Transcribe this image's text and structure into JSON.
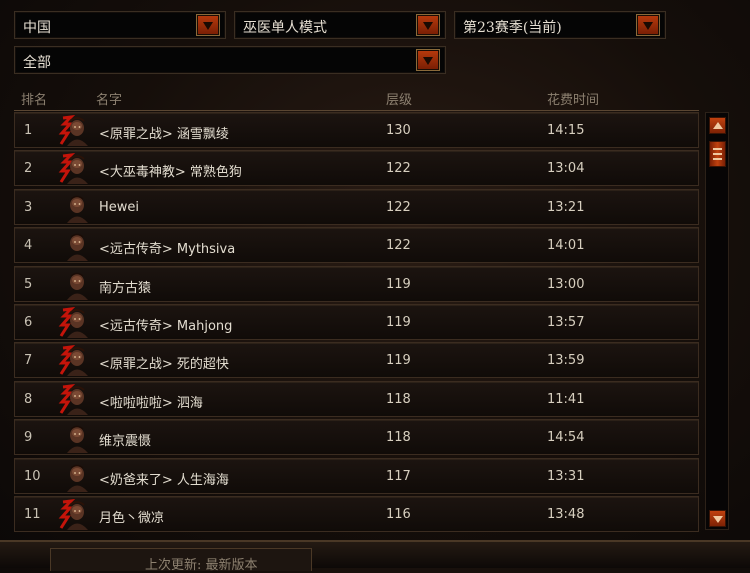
{
  "filters": {
    "region": "中国",
    "mode": "巫医单人模式",
    "season": "第23赛季(当前)",
    "category": "全部"
  },
  "columns": {
    "rank": "排名",
    "name": "名字",
    "level": "层级",
    "time": "花费时间"
  },
  "rows": [
    {
      "rank": "1",
      "name": "<原罪之战> 涵雪飘绫",
      "level": "130",
      "time": "14:15",
      "portrait": "female-witch-doctor"
    },
    {
      "rank": "2",
      "name": "<大巫毒神教> 常熟色狗",
      "level": "122",
      "time": "13:04",
      "portrait": "female-witch-doctor"
    },
    {
      "rank": "3",
      "name": "Hewei",
      "level": "122",
      "time": "13:21",
      "portrait": "male-witch-doctor"
    },
    {
      "rank": "4",
      "name": "<远古传奇> Mythsiva",
      "level": "122",
      "time": "14:01",
      "portrait": "male-witch-doctor"
    },
    {
      "rank": "5",
      "name": "南方古猿",
      "level": "119",
      "time": "13:00",
      "portrait": "male-witch-doctor"
    },
    {
      "rank": "6",
      "name": "<远古传奇> Mahjong",
      "level": "119",
      "time": "13:57",
      "portrait": "female-witch-doctor"
    },
    {
      "rank": "7",
      "name": "<原罪之战> 死的超快",
      "level": "119",
      "time": "13:59",
      "portrait": "female-witch-doctor"
    },
    {
      "rank": "8",
      "name": "<啦啦啦啦> 泗海",
      "level": "118",
      "time": "11:41",
      "portrait": "female-witch-doctor"
    },
    {
      "rank": "9",
      "name": "维京震慑",
      "level": "118",
      "time": "14:54",
      "portrait": "male-witch-doctor"
    },
    {
      "rank": "10",
      "name": "<奶爸来了> 人生海海",
      "level": "117",
      "time": "13:31",
      "portrait": "male-witch-doctor"
    },
    {
      "rank": "11",
      "name": "月色丶微凉",
      "level": "116",
      "time": "13:48",
      "portrait": "female-witch-doctor"
    }
  ],
  "footer": {
    "last_updated": "上次更新: 最新版本"
  },
  "colors": {
    "accent": "#b5390c",
    "row_bg": "#1c1410",
    "text": "#e2dccf",
    "header_text": "#8c8070"
  }
}
